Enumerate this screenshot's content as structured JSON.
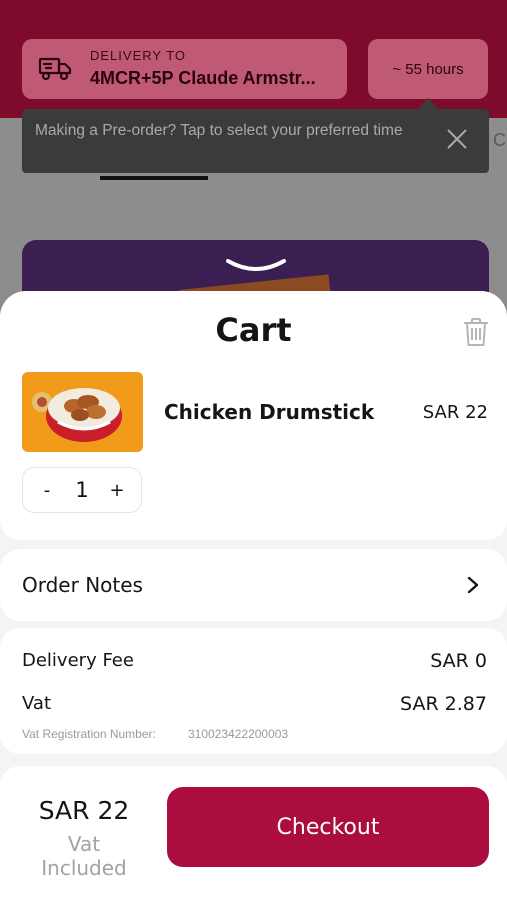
{
  "header": {
    "delivery_label": "DELIVERY TO",
    "delivery_address": "4MCR+5P Claude Armstr...",
    "eta": "~ 55 hours",
    "tooltip": "Making a Pre-order? Tap to select your preferred time",
    "partial_tab_letter": "C",
    "icons": {
      "delivery": "truck-icon",
      "tooltip_close": "close-icon"
    }
  },
  "cart": {
    "title": "Cart",
    "icons": {
      "clear": "trash-icon",
      "notes": "chevron-right-icon"
    },
    "items": [
      {
        "name": "Chicken Drumstick",
        "price": "SAR 22",
        "quantity": "1",
        "decrement": "-",
        "increment": "+"
      }
    ],
    "order_notes_label": "Order Notes",
    "fees": {
      "delivery_fee_label": "Delivery Fee",
      "delivery_fee_value": "SAR 0",
      "vat_label": "Vat",
      "vat_value": "SAR 2.87",
      "vat_reg_label": "Vat Registration Number:",
      "vat_reg_number": "310023422200003"
    },
    "footer": {
      "total": "SAR 22",
      "vat_note": "Vat Included",
      "checkout_label": "Checkout"
    }
  },
  "colors": {
    "brand": "#ac0d3f",
    "header_bg": "#7e0a2c",
    "tooltip_bg": "#3a3c3c",
    "item_image_bg": "#f29a1a"
  }
}
